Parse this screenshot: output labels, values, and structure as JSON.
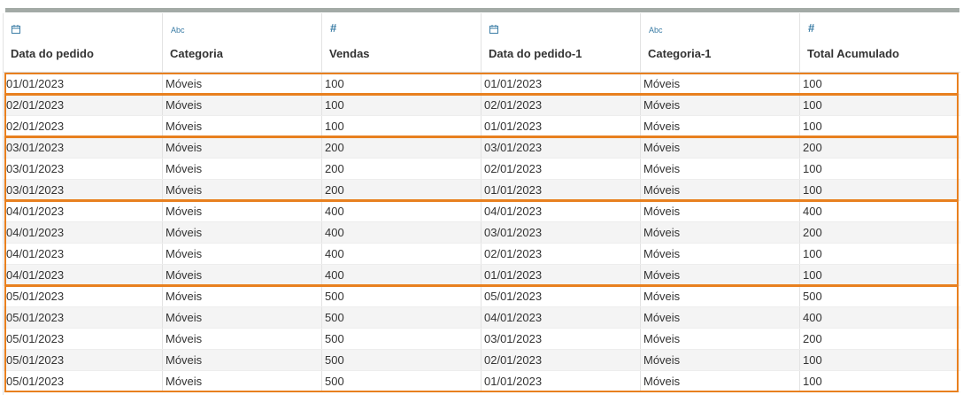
{
  "columns": [
    {
      "label": "Data do pedido",
      "type_icon": "calendar-icon",
      "type_text": ""
    },
    {
      "label": "Categoria",
      "type_icon": "string-abc-icon",
      "type_text": "Abc"
    },
    {
      "label": "Vendas",
      "type_icon": "number-hash-icon",
      "type_text": "#"
    },
    {
      "label": "Data do pedido-1",
      "type_icon": "calendar-icon",
      "type_text": ""
    },
    {
      "label": "Categoria-1",
      "type_icon": "string-abc-icon",
      "type_text": "Abc"
    },
    {
      "label": "Total Acumulado",
      "type_icon": "number-hash-icon",
      "type_text": "#"
    }
  ],
  "rows": [
    [
      "01/01/2023",
      "Móveis",
      "100",
      "01/01/2023",
      "Móveis",
      "100"
    ],
    [
      "02/01/2023",
      "Móveis",
      "100",
      "02/01/2023",
      "Móveis",
      "100"
    ],
    [
      "02/01/2023",
      "Móveis",
      "100",
      "01/01/2023",
      "Móveis",
      "100"
    ],
    [
      "03/01/2023",
      "Móveis",
      "200",
      "03/01/2023",
      "Móveis",
      "200"
    ],
    [
      "03/01/2023",
      "Móveis",
      "200",
      "02/01/2023",
      "Móveis",
      "100"
    ],
    [
      "03/01/2023",
      "Móveis",
      "200",
      "01/01/2023",
      "Móveis",
      "100"
    ],
    [
      "04/01/2023",
      "Móveis",
      "400",
      "04/01/2023",
      "Móveis",
      "400"
    ],
    [
      "04/01/2023",
      "Móveis",
      "400",
      "03/01/2023",
      "Móveis",
      "200"
    ],
    [
      "04/01/2023",
      "Móveis",
      "400",
      "02/01/2023",
      "Móveis",
      "100"
    ],
    [
      "04/01/2023",
      "Móveis",
      "400",
      "01/01/2023",
      "Móveis",
      "100"
    ],
    [
      "05/01/2023",
      "Móveis",
      "500",
      "05/01/2023",
      "Móveis",
      "500"
    ],
    [
      "05/01/2023",
      "Móveis",
      "500",
      "04/01/2023",
      "Móveis",
      "400"
    ],
    [
      "05/01/2023",
      "Móveis",
      "500",
      "03/01/2023",
      "Móveis",
      "200"
    ],
    [
      "05/01/2023",
      "Móveis",
      "500",
      "02/01/2023",
      "Móveis",
      "100"
    ],
    [
      "05/01/2023",
      "Móveis",
      "500",
      "01/01/2023",
      "Móveis",
      "100"
    ]
  ],
  "groups": [
    {
      "start": 0,
      "count": 1
    },
    {
      "start": 1,
      "count": 2
    },
    {
      "start": 3,
      "count": 3
    },
    {
      "start": 6,
      "count": 4
    },
    {
      "start": 10,
      "count": 5
    }
  ],
  "colors": {
    "highlight": "#e8801f",
    "type_icon": "#3a7ca5",
    "alt_row": "#f4f4f4"
  }
}
